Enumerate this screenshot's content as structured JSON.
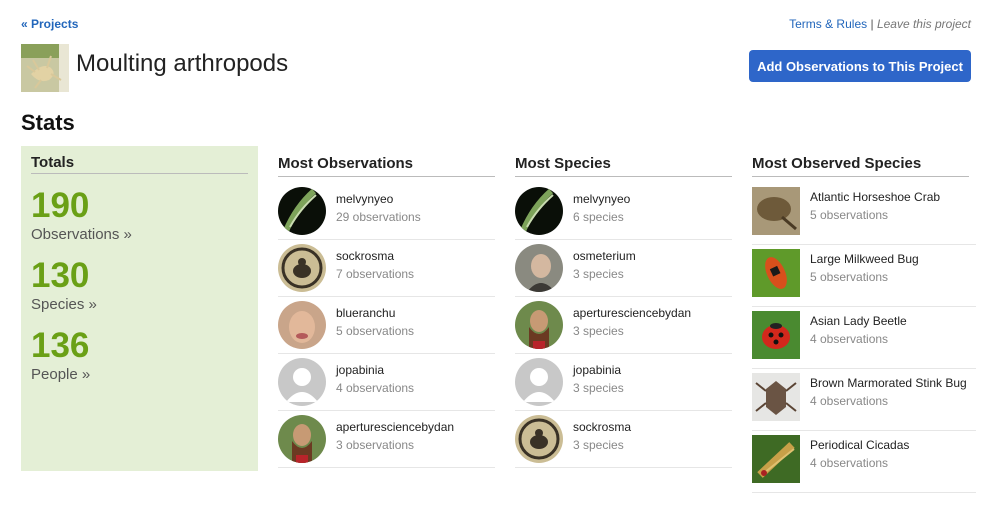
{
  "nav": {
    "back_link": "« Projects",
    "terms_link": "Terms & Rules",
    "separator": "|",
    "leave_link": "Leave this project"
  },
  "project": {
    "title": "Moulting arthropods",
    "add_button": "Add Observations to This Project"
  },
  "stats": {
    "heading": "Stats",
    "totals": {
      "heading": "Totals",
      "observations_count": "190",
      "observations_label": "Observations »",
      "species_count": "130",
      "species_label": "Species »",
      "people_count": "136",
      "people_label": "People »"
    },
    "most_observations": {
      "heading": "Most Observations",
      "users": [
        {
          "name": "melvynyeo",
          "detail": "29 observations"
        },
        {
          "name": "sockrosma",
          "detail": "7 observations"
        },
        {
          "name": "blueranchu",
          "detail": "5 observations"
        },
        {
          "name": "jopabinia",
          "detail": "4 observations"
        },
        {
          "name": "aperturesciencebydan",
          "detail": "3 observations"
        }
      ]
    },
    "most_species": {
      "heading": "Most Species",
      "users": [
        {
          "name": "melvynyeo",
          "detail": "6 species"
        },
        {
          "name": "osmeterium",
          "detail": "3 species"
        },
        {
          "name": "aperturesciencebydan",
          "detail": "3 species"
        },
        {
          "name": "jopabinia",
          "detail": "3 species"
        },
        {
          "name": "sockrosma",
          "detail": "3 species"
        }
      ]
    },
    "most_observed_species": {
      "heading": "Most Observed Species",
      "species": [
        {
          "name": "Atlantic Horseshoe Crab",
          "detail": "5 observations"
        },
        {
          "name": "Large Milkweed Bug",
          "detail": "5 observations"
        },
        {
          "name": "Asian Lady Beetle",
          "detail": "4 observations"
        },
        {
          "name": "Brown Marmorated Stink Bug",
          "detail": "4 observations"
        },
        {
          "name": "Periodical Cicadas",
          "detail": "4 observations"
        }
      ]
    }
  },
  "colors": {
    "link": "#2266bb",
    "button": "#2e66c9",
    "totals_bg": "#e4efd6",
    "stat_number": "#6aa016"
  }
}
